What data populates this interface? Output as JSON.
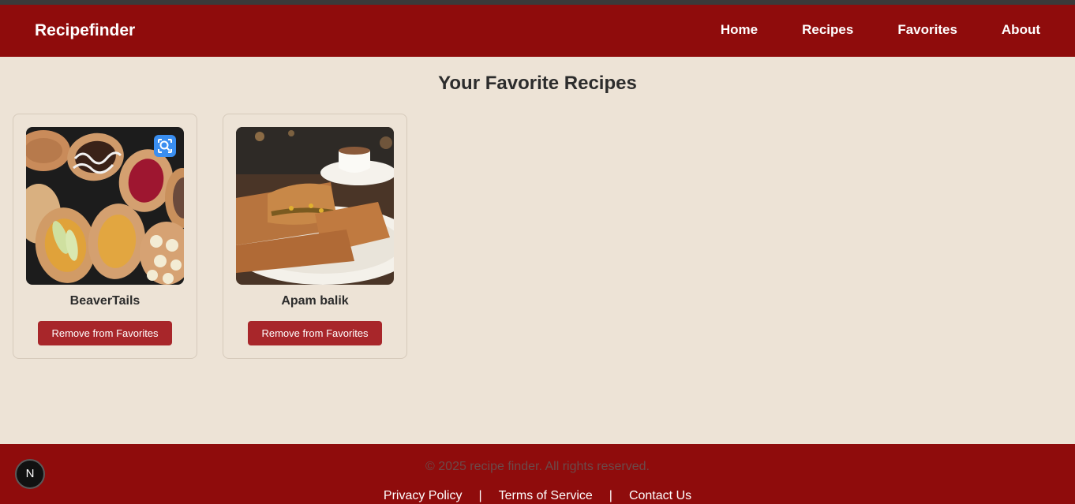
{
  "header": {
    "brand": "Recipefinder",
    "nav": [
      "Home",
      "Recipes",
      "Favorites",
      "About"
    ]
  },
  "main": {
    "title": "Your Favorite Recipes",
    "recipes": [
      {
        "name": "BeaverTails",
        "button": "Remove from Favorites",
        "image": "beavertails-pastries-photo"
      },
      {
        "name": "Apam balik",
        "button": "Remove from Favorites",
        "image": "apam-balik-pancake-photo"
      }
    ]
  },
  "footer": {
    "copyright": "© 2025 recipe finder. All rights reserved.",
    "links": [
      "Privacy Policy",
      "Terms of Service",
      "Contact Us"
    ],
    "separator": "|"
  },
  "dev_badge": "N",
  "colors": {
    "brand_red": "#8f0c0c",
    "button_red": "#a8262a",
    "background": "#ede3d6"
  }
}
